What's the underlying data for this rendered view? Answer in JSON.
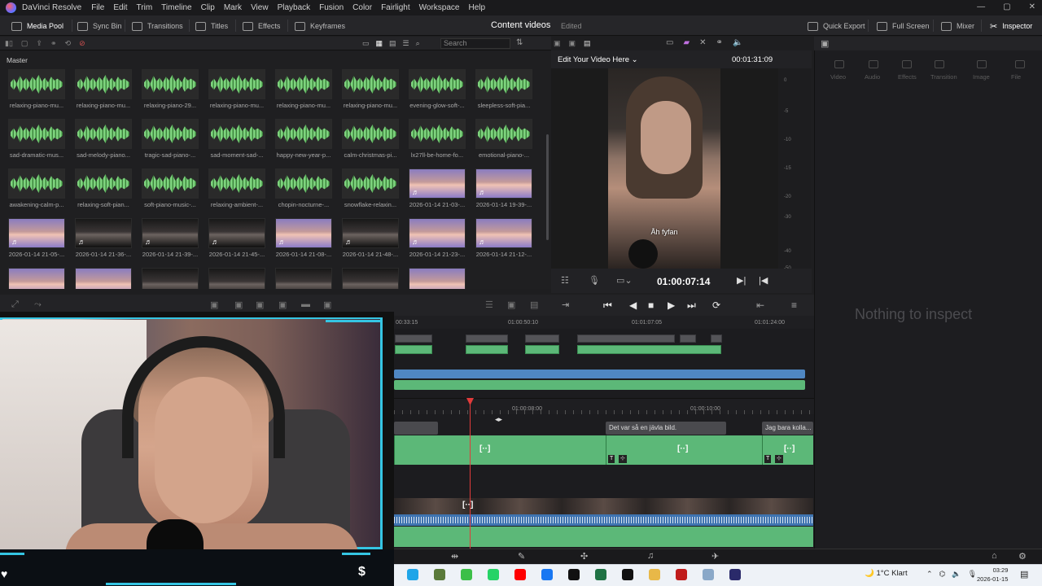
{
  "app": {
    "name": "DaVinci Resolve",
    "menu": [
      "File",
      "Edit",
      "Trim",
      "Timeline",
      "Clip",
      "Mark",
      "View",
      "Playback",
      "Fusion",
      "Color",
      "Fairlight",
      "Workspace",
      "Help"
    ]
  },
  "toolbar": {
    "left": [
      {
        "label": "Media Pool",
        "active": true
      },
      {
        "label": "Sync Bin",
        "active": false
      },
      {
        "label": "Transitions",
        "active": false
      },
      {
        "label": "Titles",
        "active": false
      },
      {
        "label": "Effects",
        "active": false
      },
      {
        "label": "Keyframes",
        "active": false
      }
    ],
    "project_title": "Content videos",
    "project_status": "Edited",
    "right": [
      {
        "label": "Quick Export",
        "active": false
      },
      {
        "label": "Full Screen",
        "active": false
      },
      {
        "label": "Mixer",
        "active": false
      },
      {
        "label": "Inspector",
        "active": true
      }
    ]
  },
  "media_pool": {
    "bin": "Master",
    "search_placeholder": "Search",
    "clips": [
      {
        "name": "relaxing-piano-mu...",
        "kind": "audio"
      },
      {
        "name": "relaxing-piano-mu...",
        "kind": "audio"
      },
      {
        "name": "relaxing-piano-29...",
        "kind": "audio"
      },
      {
        "name": "relaxing-piano-mu...",
        "kind": "audio"
      },
      {
        "name": "relaxing-piano-mu...",
        "kind": "audio"
      },
      {
        "name": "relaxing-piano-mu...",
        "kind": "audio"
      },
      {
        "name": "evening-glow-soft-...",
        "kind": "audio"
      },
      {
        "name": "sleepless-soft-pia...",
        "kind": "audio"
      },
      {
        "name": "sad-dramatic-mus...",
        "kind": "audio"
      },
      {
        "name": "sad-melody-piano...",
        "kind": "audio"
      },
      {
        "name": "tragic-sad-piano-...",
        "kind": "audio"
      },
      {
        "name": "sad-moment-sad-...",
        "kind": "audio"
      },
      {
        "name": "happy-new-year-p...",
        "kind": "audio"
      },
      {
        "name": "calm-christmas-pi...",
        "kind": "audio"
      },
      {
        "name": "lx27ll-be-home-fo...",
        "kind": "audio"
      },
      {
        "name": "emotional-piano-...",
        "kind": "audio"
      },
      {
        "name": "awakening-calm-p...",
        "kind": "audio"
      },
      {
        "name": "relaxing-soft-pian...",
        "kind": "audio"
      },
      {
        "name": "soft-piano-music-...",
        "kind": "audio"
      },
      {
        "name": "relaxing-ambient-...",
        "kind": "audio"
      },
      {
        "name": "chopin-nocturne-...",
        "kind": "audio"
      },
      {
        "name": "snowflake-relaxin...",
        "kind": "audio"
      },
      {
        "name": "2026-01-14 21-03-...",
        "kind": "video",
        "tone": "purple"
      },
      {
        "name": "2026-01-14 19-39-...",
        "kind": "video",
        "tone": "purple"
      },
      {
        "name": "2026-01-14 21-05-...",
        "kind": "video",
        "tone": "purple"
      },
      {
        "name": "2026-01-14 21-36-...",
        "kind": "video",
        "tone": "dark"
      },
      {
        "name": "2026-01-14 21-39-...",
        "kind": "video",
        "tone": "dark"
      },
      {
        "name": "2026-01-14 21-45-...",
        "kind": "video",
        "tone": "dark"
      },
      {
        "name": "2026-01-14 21-08-...",
        "kind": "video",
        "tone": "purple"
      },
      {
        "name": "2026-01-14 21-48-...",
        "kind": "video",
        "tone": "dark"
      },
      {
        "name": "2026-01-14 21-23-...",
        "kind": "video",
        "tone": "purple"
      },
      {
        "name": "2026-01-14 21-12-...",
        "kind": "video",
        "tone": "purple"
      },
      {
        "name": "",
        "kind": "video",
        "tone": "purple"
      },
      {
        "name": "",
        "kind": "video",
        "tone": "purple"
      },
      {
        "name": "",
        "kind": "video",
        "tone": "dark"
      },
      {
        "name": "",
        "kind": "video",
        "tone": "dark"
      },
      {
        "name": "",
        "kind": "video",
        "tone": "dark"
      },
      {
        "name": "",
        "kind": "video",
        "tone": "dark"
      },
      {
        "name": "",
        "kind": "video",
        "tone": "purple"
      }
    ]
  },
  "viewer": {
    "title": "Edit Your Video Here",
    "duration": "00:01:31:09",
    "subtitle": "Åh fyfan",
    "timecode": "01:00:07:14",
    "meter_ticks": [
      "0",
      "-5",
      "-10",
      "-15",
      "-20",
      "-30",
      "-40",
      "-50"
    ]
  },
  "inspector": {
    "tabs": [
      "Video",
      "Audio",
      "Effects",
      "Transition",
      "Image",
      "File"
    ],
    "empty_message": "Nothing to inspect"
  },
  "timeline": {
    "overview_ticks": [
      "00:33:15",
      "01:00:50:10",
      "01:01:07:05",
      "01:01:24:00"
    ],
    "detail_ticks": [
      "01:00:08:00",
      "01:00:10:00"
    ],
    "subtitle_clips": [
      "",
      "Det var så en jävla bild.",
      "Jag bara kolla..."
    ],
    "fx_label": "[··]",
    "title_badge": "T"
  },
  "taskbar": {
    "weather": "1°C  Klart",
    "time": "03:29",
    "date": "2026-01-15"
  },
  "colors": {
    "accent_green": "#5cb878",
    "audio_blue": "#4f87c2",
    "playhead": "#e23b3b",
    "overlay_cyan": "#35c5e3"
  }
}
